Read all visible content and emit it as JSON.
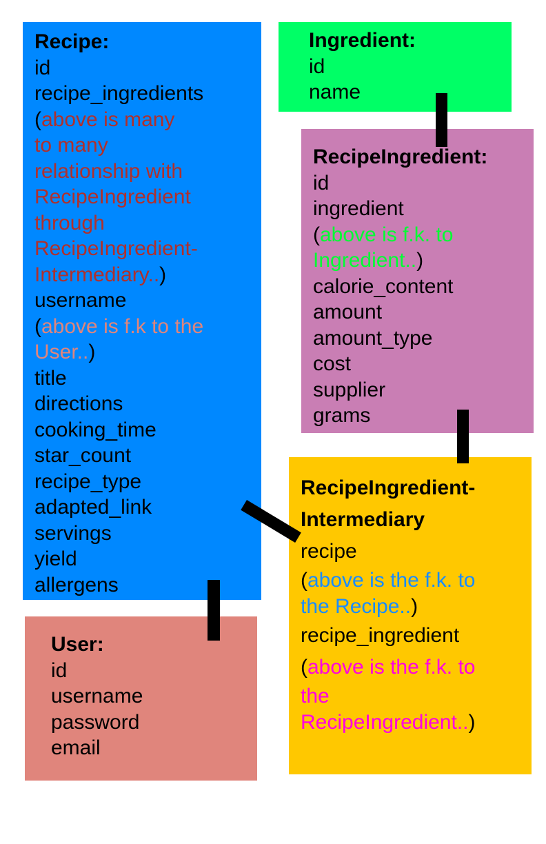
{
  "diagram": {
    "recipe": {
      "title": "Recipe:",
      "color": "#0088ff",
      "fields": {
        "id": "id",
        "recipe_ingredients": "recipe_ingredients",
        "note1_open": "(",
        "note1_lines": [
          "above is many",
          "to many",
          "relationship with",
          "RecipeIngredient",
          "through",
          "RecipeIngredient-",
          "Intermediary.."
        ],
        "note1_close": ")",
        "username": "username",
        "note2_open": "(",
        "note2_lines": [
          "above is f.k to the",
          "User.."
        ],
        "note2_close": ")",
        "rest": [
          "title",
          "directions",
          "cooking_time",
          "star_count",
          "recipe_type",
          "adapted_link",
          "servings",
          "yield",
          "allergens"
        ]
      }
    },
    "ingredient": {
      "title": "Ingredient:",
      "color": "#00ff66",
      "fields": [
        "id",
        "name"
      ]
    },
    "recipe_ingredient": {
      "title": "RecipeIngredient:",
      "color": "#c97eb4",
      "fields_before": [
        "id",
        "ingredient"
      ],
      "note_open": "(",
      "note_lines": [
        "above is f.k. to",
        "Ingredient.."
      ],
      "note_close": ")",
      "fields_after": [
        "calorie_content",
        "amount",
        "amount_type",
        "cost",
        "supplier",
        "grams"
      ]
    },
    "intermediary": {
      "title_lines": [
        "RecipeIngredient-",
        "Intermediary"
      ],
      "color": "#ffc800",
      "field1": "recipe",
      "note1_open": "(",
      "note1_lines": [
        "above is the f.k. to",
        "the Recipe.."
      ],
      "note1_close": ")",
      "field2": "recipe_ingredient",
      "note2_open": "(",
      "note2_lines": [
        "above is the f.k. to",
        "the",
        "RecipeIngredient.."
      ],
      "note2_close": ")"
    },
    "user": {
      "title": "User:",
      "color": "#e0857c",
      "fields": [
        "id",
        "username",
        "password",
        "email"
      ]
    }
  }
}
